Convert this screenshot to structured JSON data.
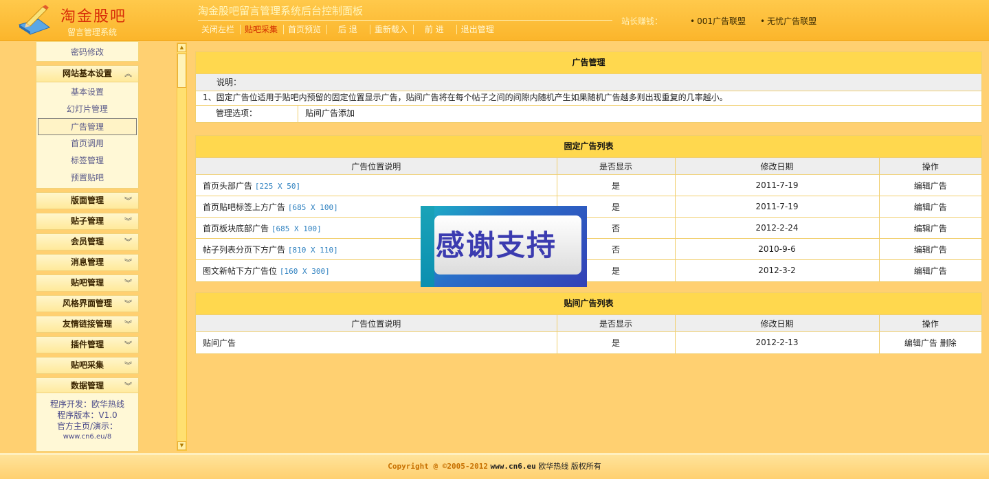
{
  "header": {
    "logo_title": "淘金股吧",
    "logo_subtitle": "留言管理系统",
    "app_title": "淘金股吧留言管理系统后台控制面板",
    "nav": [
      "关闭左栏",
      "贴吧采集",
      "首页预览",
      "后 退",
      "重新载入",
      "前 进",
      "退出管理"
    ],
    "earn_label": "站长赚钱：",
    "ad_links": [
      "001广告联盟",
      "无忧广告联盟"
    ]
  },
  "sidebar": {
    "top_item": "密码修改",
    "site_settings": {
      "label": "网站基本设置",
      "items": [
        "基本设置",
        "幻灯片管理",
        "广告管理",
        "首页调用",
        "标签管理",
        "预置贴吧"
      ],
      "active": "广告管理"
    },
    "groups": [
      "版面管理",
      "贴子管理",
      "会员管理",
      "消息管理",
      "贴吧管理",
      "风格界面管理",
      "友情链接管理",
      "插件管理",
      "贴吧采集",
      "数据管理"
    ],
    "footer": {
      "dev": "程序开发：欧华热线",
      "version": "程序版本：V1.0",
      "home": "官方主页/演示：",
      "url": "www.cn6.eu/8"
    }
  },
  "ad_manage": {
    "title": "广告管理",
    "note_label": "说明：",
    "note_text": "1、固定广告位适用于贴吧内预留的固定位置显示广告，贴间广告将在每个帖子之间的间隙内随机产生如果随机广告越多则出现重复的几率越小。",
    "options_label": "管理选项：",
    "options_value": "贴间广告添加"
  },
  "fixed_ads": {
    "title": "固定广告列表",
    "columns": [
      "广告位置说明",
      "是否显示",
      "修改日期",
      "操作"
    ],
    "rows": [
      {
        "desc": "首页头部广告",
        "size": "[225 X 50]",
        "show": "是",
        "date": "2011-7-19",
        "op": "编辑广告"
      },
      {
        "desc": "首页贴吧标签上方广告",
        "size": "[685 X 100]",
        "show": "是",
        "date": "2011-7-19",
        "op": "编辑广告"
      },
      {
        "desc": "首页板块底部广告",
        "size": "[685 X 100]",
        "show": "否",
        "date": "2012-2-24",
        "op": "编辑广告"
      },
      {
        "desc": "帖子列表分页下方广告",
        "size": "[810 X 110]",
        "show": "否",
        "date": "2010-9-6",
        "op": "编辑广告"
      },
      {
        "desc": "图文新帖下方广告位",
        "size": "[160 X 300]",
        "show": "是",
        "date": "2012-3-2",
        "op": "编辑广告"
      }
    ]
  },
  "between_ads": {
    "title": "贴间广告列表",
    "columns": [
      "广告位置说明",
      "是否显示",
      "修改日期",
      "操作"
    ],
    "rows": [
      {
        "desc": "贴间广告",
        "show": "是",
        "date": "2012-2-13",
        "op_edit": "编辑广告",
        "op_delete": "删除"
      }
    ]
  },
  "overlay": {
    "text": "感谢支持"
  },
  "footer": {
    "copyright": "Copyright @ ©2005-2012",
    "site": "www.cn6.eu",
    "owner": "欧华热线 版权所有"
  },
  "icons": {
    "logo": "pencil-book-icon",
    "collapse": "chevron-up-double-icon",
    "expand": "chevron-down-double-icon",
    "scroll_up": "arrow-up-icon",
    "scroll_down": "arrow-down-icon"
  },
  "colors": {
    "header_bg": "#fbb52b",
    "page_bg": "#ffd071",
    "panel_head": "#ffd84e",
    "active_nav": "#d02a00",
    "size_text": "#2b7fbf"
  }
}
